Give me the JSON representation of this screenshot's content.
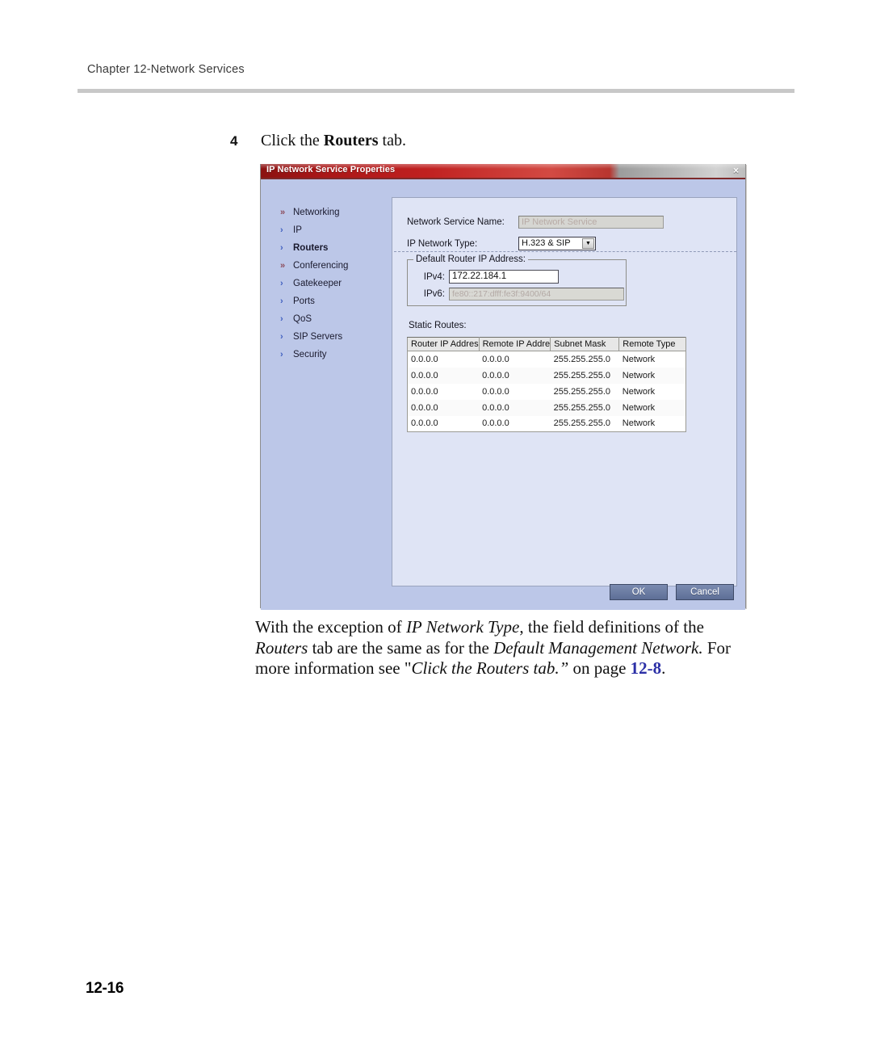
{
  "page": {
    "running_header": "Chapter 12-Network Services",
    "page_number": "12-16"
  },
  "step": {
    "number": "4",
    "text_before": "Click the ",
    "text_bold": "Routers",
    "text_after": " tab."
  },
  "dialog": {
    "title": "IP Network Service Properties",
    "close_icon": "×",
    "sidebar": {
      "items": [
        {
          "label": "Networking",
          "marker": "»",
          "selected": false
        },
        {
          "label": "IP",
          "marker": "›",
          "selected": false
        },
        {
          "label": "Routers",
          "marker": "›",
          "selected": true
        },
        {
          "label": "Conferencing",
          "marker": "»",
          "selected": false
        },
        {
          "label": "Gatekeeper",
          "marker": "›",
          "selected": false
        },
        {
          "label": "Ports",
          "marker": "›",
          "selected": false
        },
        {
          "label": "QoS",
          "marker": "›",
          "selected": false
        },
        {
          "label": "SIP Servers",
          "marker": "›",
          "selected": false
        },
        {
          "label": "Security",
          "marker": "›",
          "selected": false
        }
      ]
    },
    "fields": {
      "network_service_name_label": "Network Service Name:",
      "network_service_name_value": "IP Network Service",
      "ip_network_type_label": "IP Network Type:",
      "ip_network_type_value": "H.323 & SIP",
      "dropdown_arrow": "▼"
    },
    "group": {
      "legend": "Default Router IP Address:",
      "ipv4_label": "IPv4:",
      "ipv4_value": "172.22.184.1",
      "ipv6_label": "IPv6:",
      "ipv6_value": "fe80::217:dfff:fe3f:9400/64"
    },
    "static_routes": {
      "label": "Static Routes:",
      "columns": [
        "Router IP Addres",
        "Remote IP Addre",
        "Subnet Mask",
        "Remote Type"
      ],
      "rows": [
        [
          "0.0.0.0",
          "0.0.0.0",
          "255.255.255.0",
          "Network"
        ],
        [
          "0.0.0.0",
          "0.0.0.0",
          "255.255.255.0",
          "Network"
        ],
        [
          "0.0.0.0",
          "0.0.0.0",
          "255.255.255.0",
          "Network"
        ],
        [
          "0.0.0.0",
          "0.0.0.0",
          "255.255.255.0",
          "Network"
        ],
        [
          "0.0.0.0",
          "0.0.0.0",
          "255.255.255.0",
          "Network"
        ]
      ]
    },
    "buttons": {
      "ok": "OK",
      "cancel": "Cancel"
    }
  },
  "paragraph": {
    "s1": "With the exception of ",
    "i1": "IP Network Type",
    "s2": ", the field definitions of the ",
    "i2": "Routers",
    "s3": " tab are the same as for the ",
    "i3": "Default Management Network.",
    "s4": " For more information see \"",
    "i4": "Click the Routers tab.”",
    "s5": " on page ",
    "link": "12-8",
    "s6": "."
  },
  "colors": {
    "title_red": "#c02020",
    "dialog_bg": "#bcc7e8",
    "panel_bg": "#dfe4f5",
    "link_blue": "#2b2fa6"
  }
}
